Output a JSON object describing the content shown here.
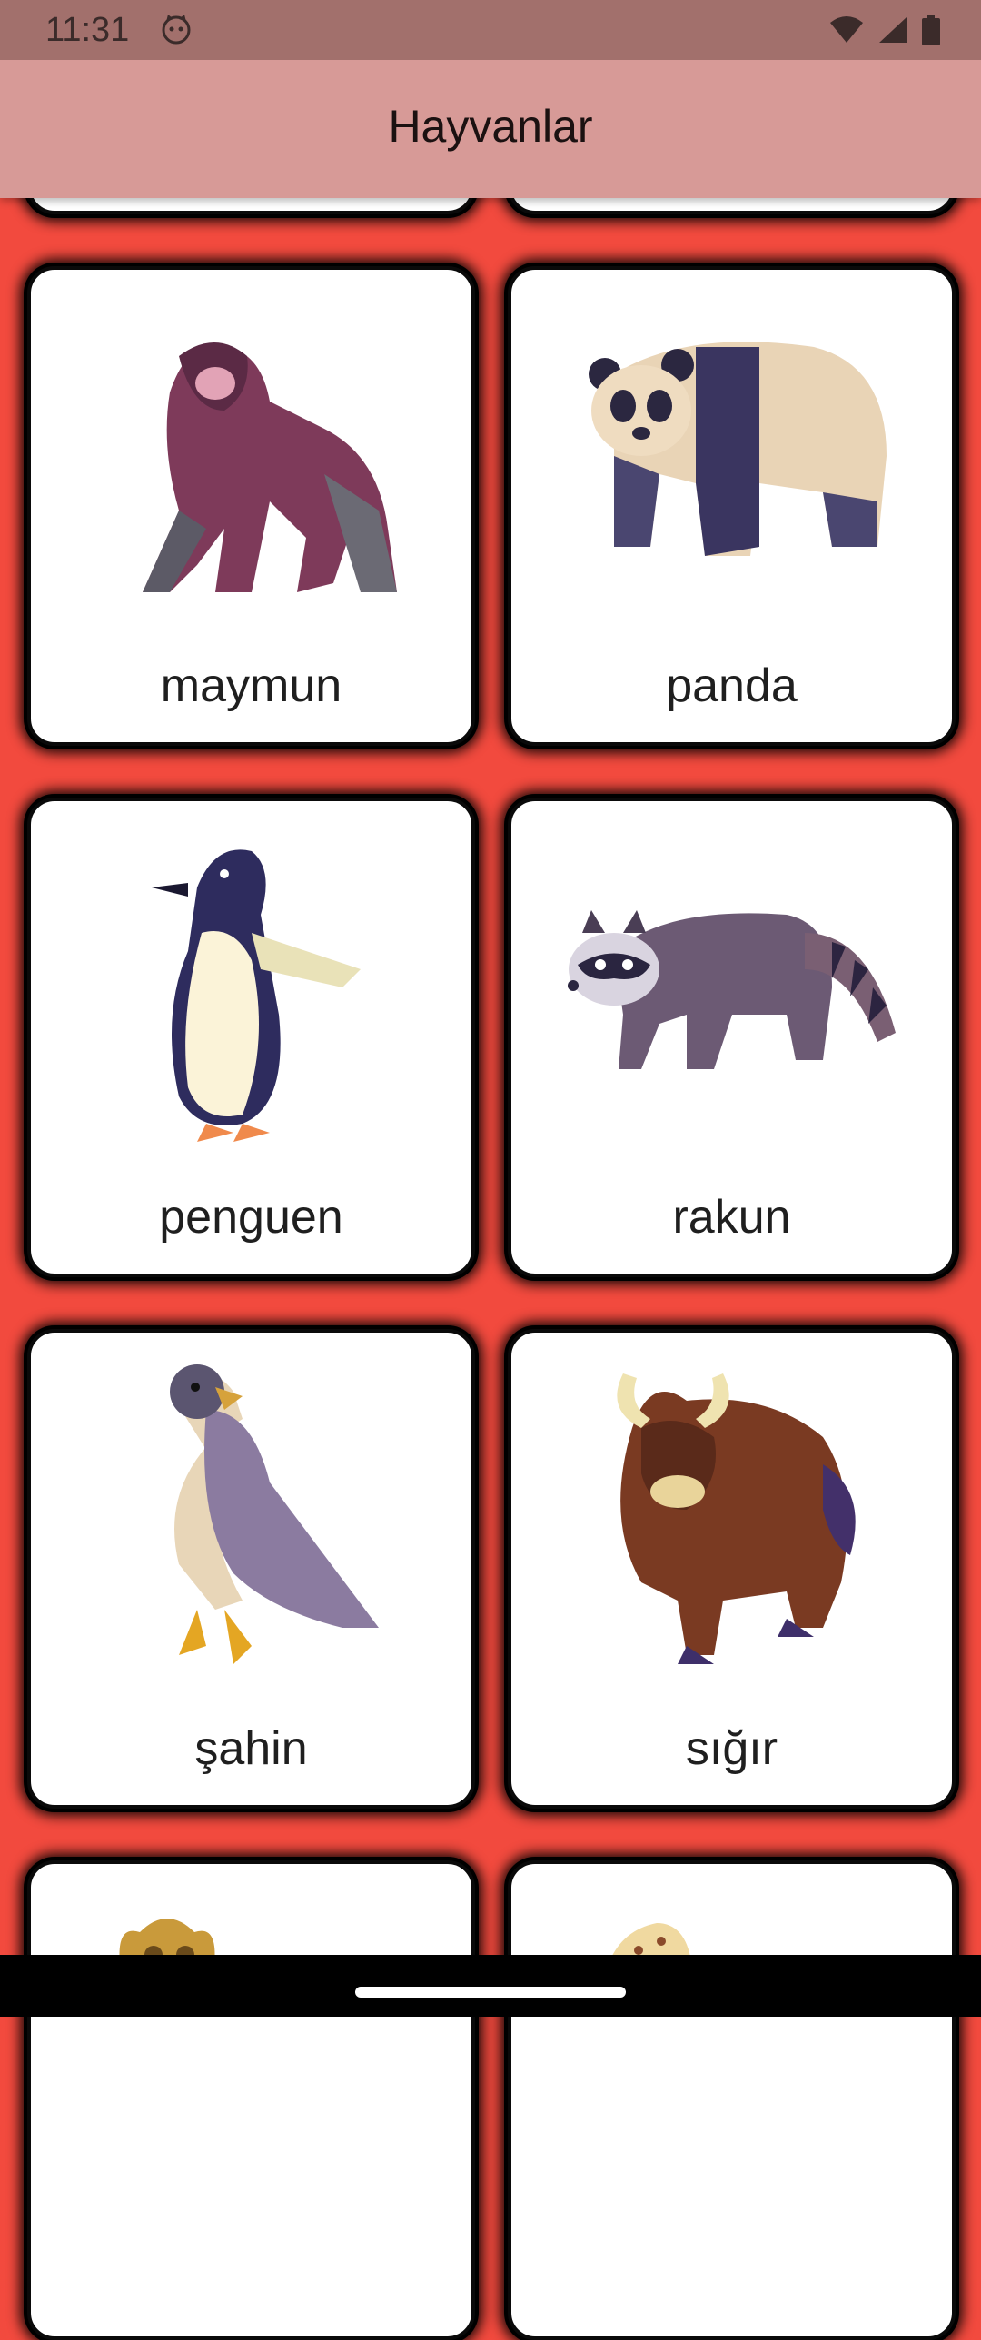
{
  "status_bar": {
    "time": "11:31",
    "icons": [
      "cat-face-icon",
      "wifi-icon",
      "signal-icon",
      "battery-icon"
    ]
  },
  "app_bar": {
    "title": "Hayvanlar"
  },
  "colors": {
    "background": "#f24a3e",
    "app_bar": "#d79a97",
    "status_bar": "#a2706c",
    "card": "#ffffff"
  },
  "animals": [
    {
      "label": "maymun",
      "icon": "gorilla-icon"
    },
    {
      "label": "panda",
      "icon": "panda-icon"
    },
    {
      "label": "penguen",
      "icon": "penguin-icon"
    },
    {
      "label": "rakun",
      "icon": "raccoon-icon"
    },
    {
      "label": "şahin",
      "icon": "falcon-icon"
    },
    {
      "label": "sığır",
      "icon": "yak-icon"
    }
  ]
}
